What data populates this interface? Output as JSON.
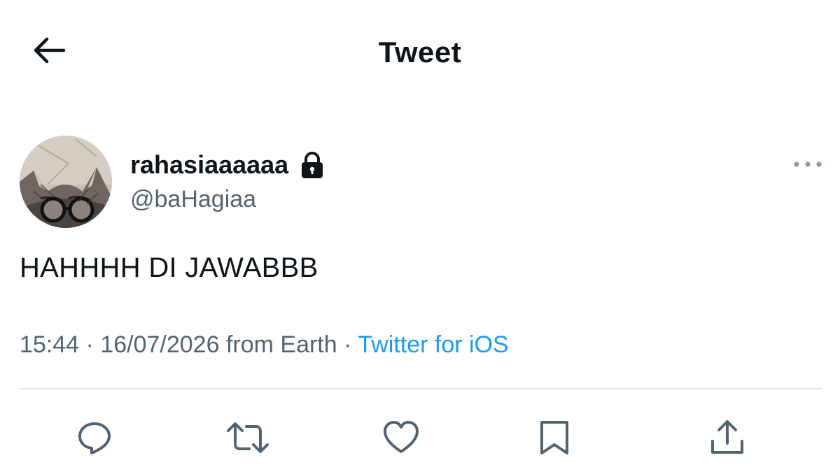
{
  "header": {
    "title": "Tweet",
    "back_icon": "arrow-left-icon"
  },
  "tweet": {
    "author": {
      "display_name": "rahasiaaaaaa",
      "handle": "@baHagiaa",
      "protected_icon": "lock-icon",
      "avatar": "cat-with-glasses"
    },
    "text": "HAHHHH DI JAWABBB",
    "time": "15:44",
    "date": "16/07/2026",
    "location": "from Earth",
    "separator": "·",
    "source": "Twitter for iOS",
    "more_icon": "more-horizontal-icon"
  },
  "actions": [
    {
      "name": "reply",
      "icon": "reply-icon"
    },
    {
      "name": "retweet",
      "icon": "retweet-icon"
    },
    {
      "name": "like",
      "icon": "heart-icon"
    },
    {
      "name": "bookmark",
      "icon": "bookmark-icon"
    },
    {
      "name": "share",
      "icon": "share-icon"
    }
  ],
  "colors": {
    "text_primary": "#0f1419",
    "text_secondary": "#536471",
    "link": "#1d9bf0",
    "divider": "#dfe4e8",
    "icon_gray": "#536471"
  }
}
